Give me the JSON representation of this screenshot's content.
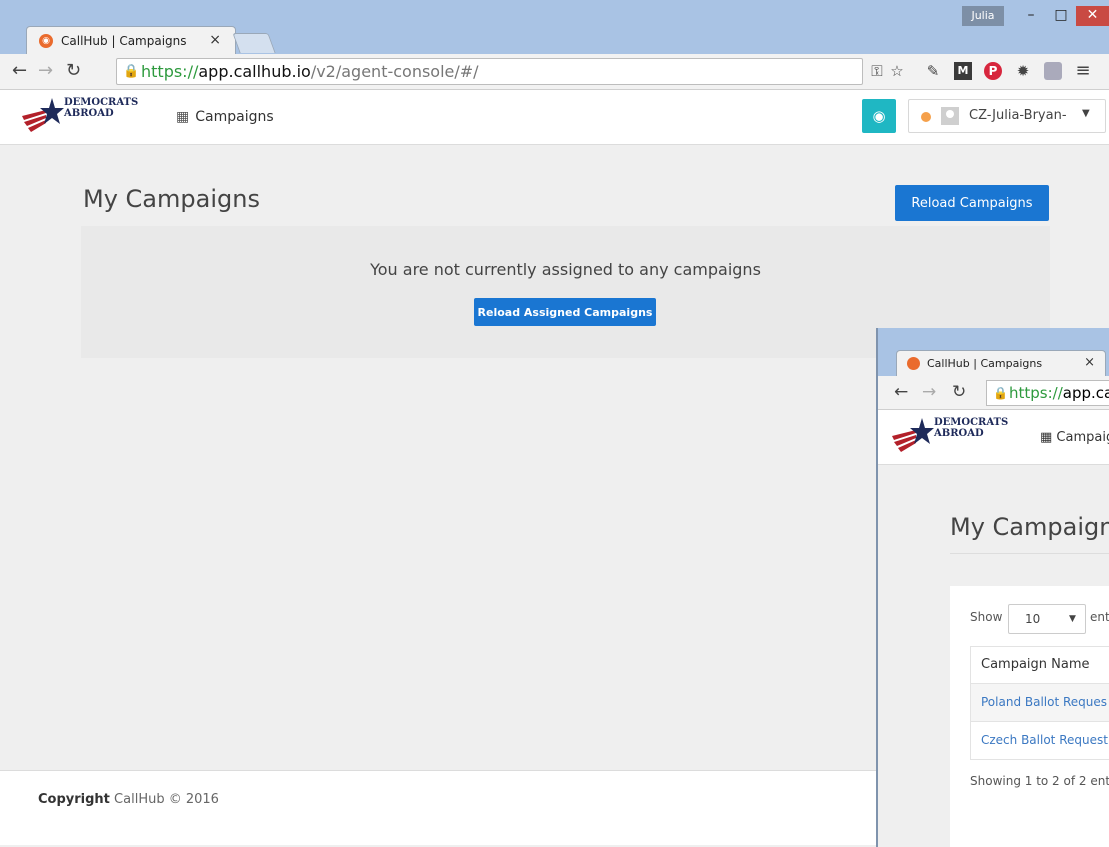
{
  "browser": {
    "tab_title": "CallHub | Campaigns",
    "tab_close": "×",
    "user_badge": "Julia",
    "window_controls": {
      "minimize": "–",
      "maximize": "□",
      "close": "✕"
    },
    "url_scheme": "https://",
    "url_host": "app.callhub.io",
    "url_path": "/v2/agent-console/#/"
  },
  "app": {
    "logo_line1": "DEMOCRATS",
    "logo_line2": "ABROAD",
    "nav_campaigns": "Campaigns",
    "agent_name": "CZ-Julia-Bryan-",
    "status_color": "#f5a04a",
    "accent_color": "#1a76d2"
  },
  "main": {
    "title": "My Campaigns",
    "reload_button": "Reload Campaigns",
    "empty_message": "You are not currently assigned to any campaigns",
    "reload_assigned_button": "Reload Assigned Campaigns"
  },
  "footer": {
    "copyright_label": "Copyright",
    "copyright_text": "CallHub © 2016"
  },
  "second_window": {
    "tab_title": "CallHub | Campaigns",
    "tab_close": "×",
    "url_scheme": "https://",
    "url_host_partial": "app.ca",
    "logo_line1": "DEMOCRATS",
    "logo_line2": "ABROAD",
    "nav_campaigns": "Campaig",
    "title": "My Campaigns",
    "show_label": "Show",
    "show_value": "10",
    "entries_label": "ent",
    "table_header": "Campaign Name",
    "rows": [
      "Poland Ballot Reques",
      "Czech Ballot Request"
    ],
    "info_text": "Showing 1 to 2 of 2 ent"
  }
}
